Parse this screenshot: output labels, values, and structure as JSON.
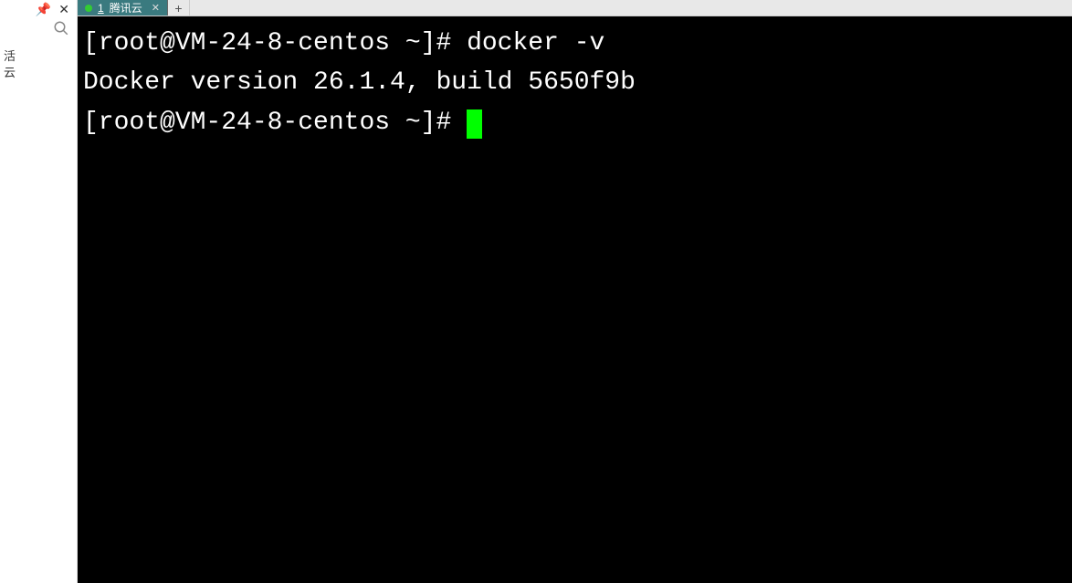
{
  "sidebar": {
    "text1": "活",
    "text2": "云"
  },
  "tabs": [
    {
      "number": "1",
      "label": "腾讯云",
      "active": true
    }
  ],
  "terminal": {
    "line1_prompt": "[root@VM-24-8-centos ~]# ",
    "line1_cmd": "docker -v",
    "line2": "Docker version 26.1.4, build 5650f9b",
    "line3_prompt": "[root@VM-24-8-centos ~]# "
  }
}
